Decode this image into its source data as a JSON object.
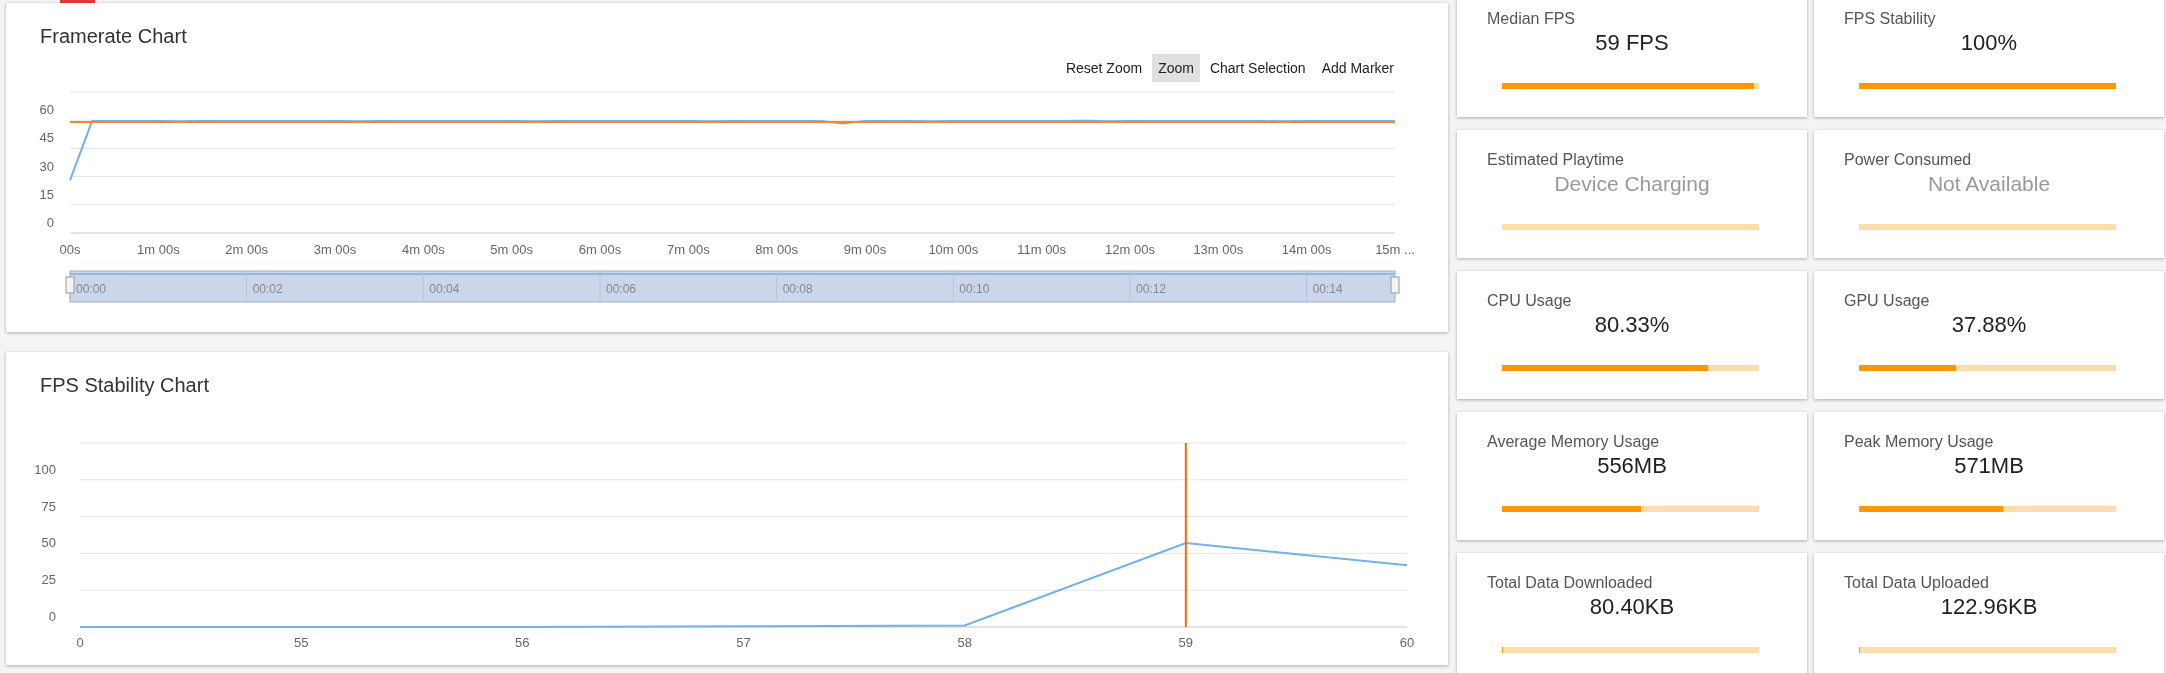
{
  "framerate_chart": {
    "title": "Framerate Chart",
    "toolbar": [
      {
        "label": "Reset Zoom",
        "selected": false
      },
      {
        "label": "Zoom",
        "selected": true
      },
      {
        "label": "Chart Selection",
        "selected": false
      },
      {
        "label": "Add Marker",
        "selected": false
      }
    ],
    "chart_data": {
      "type": "line",
      "categories": [
        "00s",
        null,
        null,
        null,
        "1m 00s",
        null,
        null,
        null,
        "2m 00s",
        null,
        null,
        null,
        "3m 00s",
        null,
        null,
        null,
        "4m 00s",
        null,
        null,
        null,
        "5m 00s",
        null,
        null,
        null,
        "6m 00s",
        null,
        null,
        null,
        "7m 00s",
        null,
        null,
        null,
        "8m 00s",
        null,
        null,
        null,
        "9m 00s",
        null,
        null,
        null,
        "10m 00s",
        null,
        null,
        null,
        "11m 00s",
        null,
        null,
        null,
        "12m 00s",
        null,
        null,
        null,
        "13m 00s",
        null,
        null,
        null,
        "14m 00s",
        null,
        null,
        null,
        "15m ..."
      ],
      "series": [
        {
          "color": "#74b0ea",
          "values": [
            28,
            59.5,
            59.6,
            59.5,
            59.6,
            59.4,
            59.6,
            59.5,
            59.6,
            59.5,
            59.6,
            59.5,
            59.6,
            59.4,
            59.6,
            59.5,
            59.6,
            59.5,
            59.6,
            59.5,
            59.6,
            59.4,
            59.6,
            59.5,
            59.6,
            59.5,
            59.6,
            59.5,
            59.6,
            59.4,
            59.6,
            59.5,
            59.6,
            59.5,
            59.6,
            58.2,
            59.6,
            59.5,
            59.6,
            59.4,
            59.6,
            59.5,
            59.6,
            59.5,
            59.6,
            59.5,
            59.7,
            59.4,
            59.6,
            59.5,
            59.6,
            59.5,
            59.6,
            59.5,
            59.6,
            59.4,
            59.6,
            59.5,
            59.6,
            59.5,
            59.6
          ]
        },
        {
          "color": "#f08a24",
          "values": [
            59,
            59,
            59,
            59,
            59,
            59,
            59,
            59,
            59,
            59,
            59,
            59,
            59,
            59,
            59,
            59,
            59,
            59,
            59,
            59,
            59,
            59,
            59,
            59,
            59,
            59,
            59,
            59,
            59,
            59,
            59,
            59,
            59,
            59,
            59,
            59,
            59,
            59,
            59,
            59,
            59,
            59,
            59,
            59,
            59,
            59,
            59,
            59,
            59,
            59,
            59,
            59,
            59,
            59,
            59,
            59,
            59,
            59,
            59,
            59,
            59
          ]
        }
      ],
      "ylim": [
        0,
        75
      ],
      "yticks": [
        0,
        15,
        30,
        45,
        60
      ],
      "grid": true
    },
    "navigator": {
      "labels": [
        "00:00",
        "00:02",
        "00:04",
        "00:06",
        "00:08",
        "00:10",
        "00:12",
        "00:14"
      ]
    }
  },
  "stability_chart": {
    "title": "FPS Stability Chart",
    "chart_data": {
      "type": "line",
      "categories": [
        "0",
        "55",
        "56",
        "57",
        "58",
        "59",
        "60"
      ],
      "series": [
        {
          "color": "#74b0ea",
          "values": [
            0,
            0,
            0,
            0.5,
            1,
            57,
            42
          ]
        }
      ],
      "ylim": [
        0,
        125
      ],
      "yticks": [
        0,
        25,
        50,
        75,
        100
      ],
      "grid": true,
      "ref_lines": [
        {
          "axis": "x",
          "value": "59",
          "color": "#f06c00"
        }
      ]
    }
  },
  "metrics": [
    {
      "title": "Median FPS",
      "value": "59 FPS",
      "kind": "value",
      "level": 0.98
    },
    {
      "title": "FPS Stability",
      "value": "100%",
      "kind": "value",
      "level": 1
    },
    {
      "title": "Estimated Playtime",
      "value": "Device Charging",
      "kind": "unavailable",
      "level": 0
    },
    {
      "title": "Power Consumed",
      "value": "Not Available",
      "kind": "unavailable",
      "level": 0
    },
    {
      "title": "CPU Usage",
      "value": "80.33%",
      "kind": "value",
      "level": 0.803
    },
    {
      "title": "GPU Usage",
      "value": "37.88%",
      "kind": "value",
      "level": 0.379
    },
    {
      "title": "Average Memory Usage",
      "value": "556MB",
      "kind": "value",
      "level": 0.54
    },
    {
      "title": "Peak Memory Usage",
      "value": "571MB",
      "kind": "value",
      "level": 0.56
    },
    {
      "title": "Total Data Downloaded",
      "value": "80.40KB",
      "kind": "value",
      "level": 0.005
    },
    {
      "title": "Total Data Uploaded",
      "value": "122.96KB",
      "kind": "value",
      "level": 0.003
    }
  ]
}
